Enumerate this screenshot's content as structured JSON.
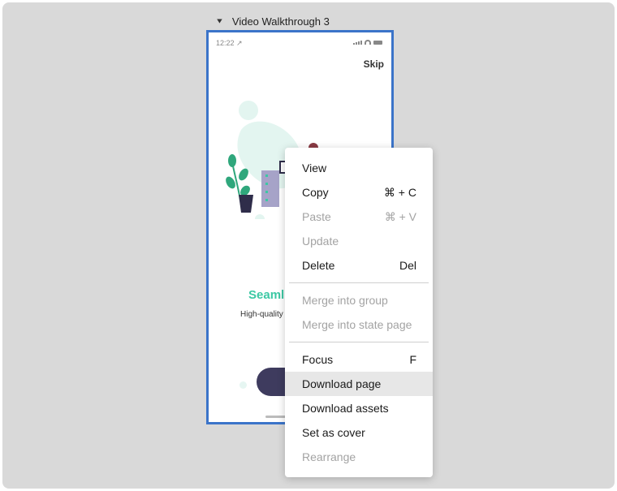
{
  "frame": {
    "title": "Video Walkthrough 3",
    "status_time": "12:22 ↗",
    "skip_label": "Skip",
    "title_partial": "Seaml",
    "subtitle_partial": "High-quality"
  },
  "colors": {
    "selection_border": "#3b74c9",
    "accent_green": "#3cc8a4",
    "button_dark": "#3e3b5e"
  },
  "context_menu": {
    "items": [
      {
        "label": "View",
        "shortcut": "",
        "disabled": false
      },
      {
        "label": "Copy",
        "shortcut": "⌘ + C",
        "disabled": false
      },
      {
        "label": "Paste",
        "shortcut": "⌘ + V",
        "disabled": true
      },
      {
        "label": "Update",
        "shortcut": "",
        "disabled": true
      },
      {
        "label": "Delete",
        "shortcut": "Del",
        "disabled": false
      },
      {
        "label": "Merge into group",
        "shortcut": "",
        "disabled": true
      },
      {
        "label": "Merge into state page",
        "shortcut": "",
        "disabled": true
      },
      {
        "label": "Focus",
        "shortcut": "F",
        "disabled": false
      },
      {
        "label": "Download page",
        "shortcut": "",
        "disabled": false,
        "highlighted": true
      },
      {
        "label": "Download assets",
        "shortcut": "",
        "disabled": false
      },
      {
        "label": "Set as cover",
        "shortcut": "",
        "disabled": false
      },
      {
        "label": "Rearrange",
        "shortcut": "",
        "disabled": true
      }
    ]
  }
}
